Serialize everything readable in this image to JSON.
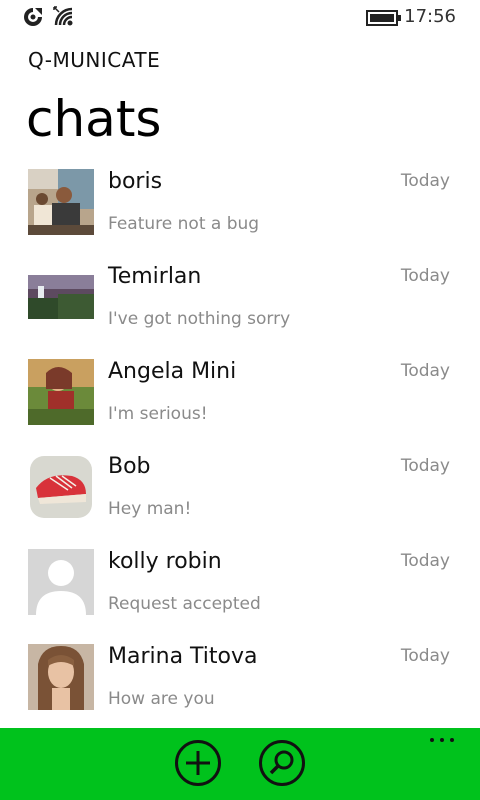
{
  "status_bar": {
    "time": "17:56",
    "icons": [
      "location-sync-icon",
      "wifi-icon",
      "battery-icon"
    ]
  },
  "header": {
    "app_title": "Q-MUNICATE",
    "page_title": "chats"
  },
  "chats": [
    {
      "name": "boris",
      "last_message": "Feature not a bug",
      "time": "Today",
      "avatar": "photo"
    },
    {
      "name": "Temirlan",
      "last_message": "I've got nothing sorry",
      "time": "Today",
      "avatar": "photo"
    },
    {
      "name": "Angela Mini",
      "last_message": "I'm serious!",
      "time": "Today",
      "avatar": "photo"
    },
    {
      "name": "Bob",
      "last_message": "Hey man!",
      "time": "Today",
      "avatar": "photo"
    },
    {
      "name": "kolly robin",
      "last_message": "Request accepted",
      "time": "Today",
      "avatar": "default-person"
    },
    {
      "name": "Marina Titova",
      "last_message": "How are you",
      "time": "Today",
      "avatar": "photo"
    }
  ],
  "app_bar": {
    "background": "#00c21c",
    "buttons": [
      "add-icon",
      "search-icon"
    ],
    "more": "more-icon"
  }
}
